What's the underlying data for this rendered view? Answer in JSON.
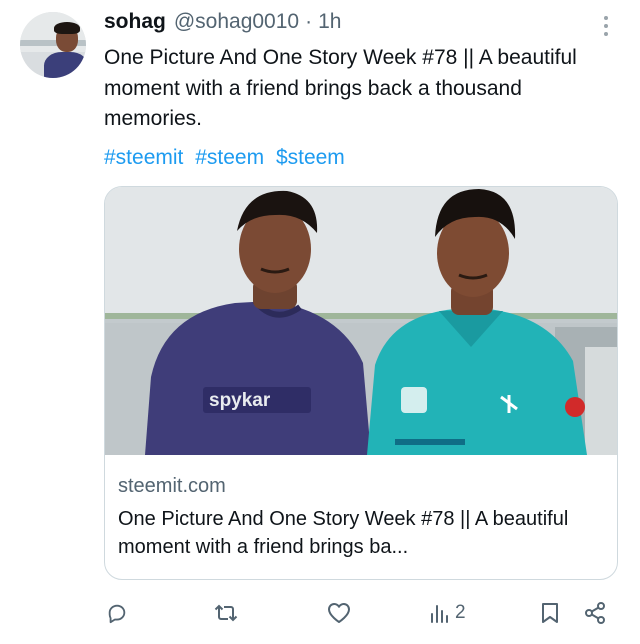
{
  "author": {
    "name": "sohag",
    "handle": "@sohag0010",
    "separator": "·",
    "time": "1h",
    "avatar_icon": "profile-photo"
  },
  "tweet": {
    "text": "One Picture And One Story Week #78 ||  A beautiful moment with a friend brings back a thousand memories.",
    "hashtags": [
      "#steemit",
      "#steem",
      "$steem"
    ]
  },
  "card": {
    "image_icon": "two-young-men-photo",
    "image_text": {
      "shirt_left": "spykar"
    },
    "domain": "steemit.com",
    "title": "One Picture And One Story Week #78 || A beautiful moment with a friend brings ba..."
  },
  "actions": {
    "reply_icon": "reply-icon",
    "retweet_icon": "retweet-icon",
    "like_icon": "heart-icon",
    "views_icon": "views-icon",
    "views_count": "2",
    "bookmark_icon": "bookmark-icon",
    "share_icon": "share-icon"
  },
  "colors": {
    "link": "#1d9bf0",
    "secondary_text": "#536471",
    "primary_text": "#0f1419",
    "border": "#cfd9de"
  }
}
